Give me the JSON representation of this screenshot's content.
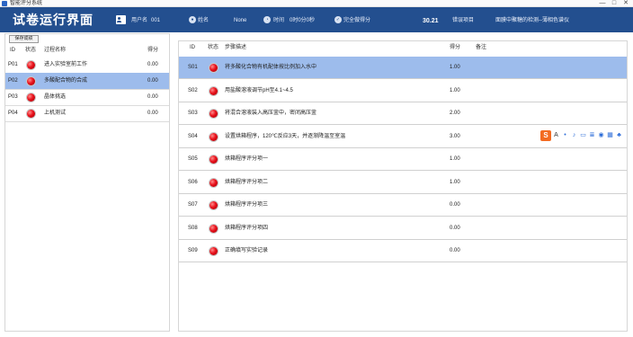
{
  "window": {
    "title": "智能评分系统",
    "minimize": "—",
    "maximize": "□",
    "close": "✕"
  },
  "header": {
    "title": "试卷运行界面",
    "username_label": "用户名",
    "username_value": "001",
    "name_label": "姓名",
    "name_value": "None",
    "time_label": "时间",
    "time_value": "0时0分0秒",
    "score_label": "完全做得分",
    "score_value": "30.21",
    "step_label": "错误项目",
    "message": "面膜中聚糖的检测--薄相色谱仪"
  },
  "left": {
    "save_label": "保存成绩",
    "columns": {
      "id": "ID",
      "status": "状态",
      "name": "过程名称",
      "score": "得分"
    },
    "rows": [
      {
        "id": "P01",
        "name": "进入实验室前工作",
        "score": "0.00"
      },
      {
        "id": "P02",
        "name": "多酸配合物的合成",
        "score": "0.00"
      },
      {
        "id": "P03",
        "name": "晶体挑选",
        "score": "0.00"
      },
      {
        "id": "P04",
        "name": "上机测试",
        "score": "0.00"
      }
    ]
  },
  "right": {
    "columns": {
      "id": "ID",
      "status": "状态",
      "desc": "步骤描述",
      "score": "得分",
      "remark": "备注"
    },
    "rows": [
      {
        "id": "S01",
        "desc": "将多酸化合物有机配体按比例加入水中",
        "score": "1.00"
      },
      {
        "id": "S02",
        "desc": "用盐酸溶液调节pH至4.1~4.5",
        "score": "1.00"
      },
      {
        "id": "S03",
        "desc": "将混合溶液装入高压釜中，密闭高压釜",
        "score": "2.00"
      },
      {
        "id": "S04",
        "desc": "设置烘箱程序，120℃反应3天，并逐渐降温至室温",
        "score": "3.00"
      },
      {
        "id": "S05",
        "desc": "烘箱程序评分项一",
        "score": "1.00"
      },
      {
        "id": "S06",
        "desc": "烘箱程序评分项二",
        "score": "1.00"
      },
      {
        "id": "S07",
        "desc": "烘箱程序评分项三",
        "score": "0.00"
      },
      {
        "id": "S08",
        "desc": "烘箱程序评分项四",
        "score": "0.00"
      },
      {
        "id": "S09",
        "desc": "正确填写实验记录",
        "score": "0.00"
      }
    ]
  },
  "ime": {
    "logo": "S",
    "items": [
      "A",
      "•",
      "♪",
      "▭",
      "≣",
      "◉",
      "▦",
      "♣"
    ]
  },
  "colors": {
    "header": "#234f8f",
    "selected_row": "#9dbcec",
    "status_led": "#e8101a"
  }
}
